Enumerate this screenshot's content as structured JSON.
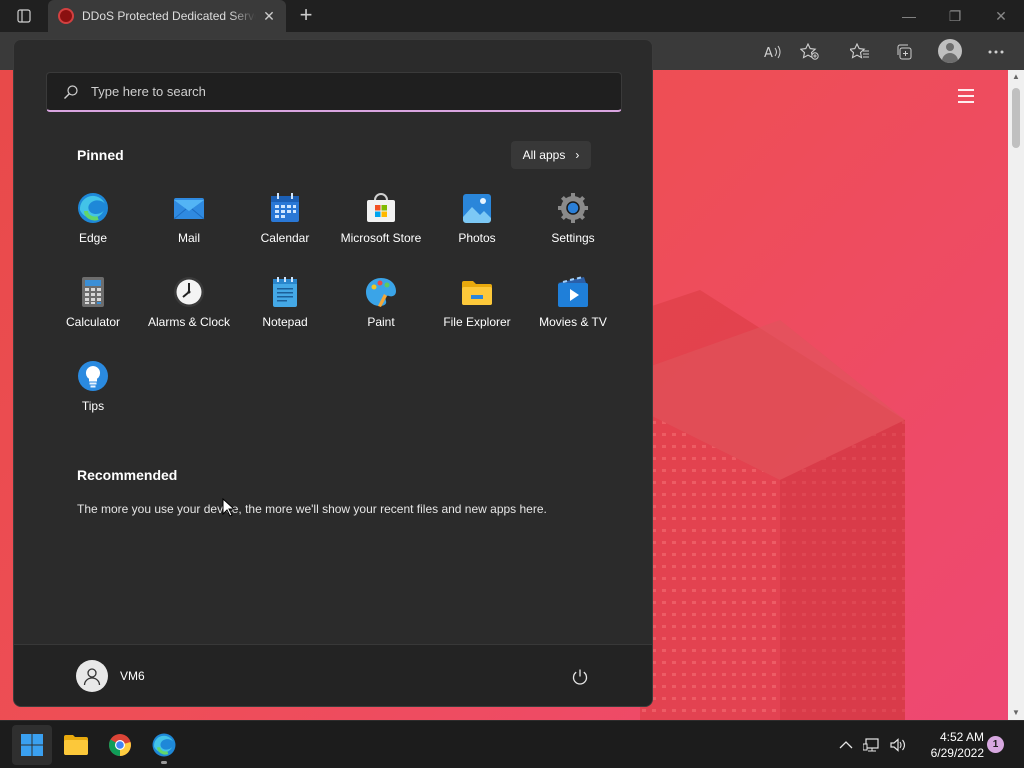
{
  "browser": {
    "tab": {
      "title": "DDoS Protected Dedicated Servers",
      "close_glyph": "✕"
    },
    "new_tab_glyph": "+",
    "window_controls": {
      "minimize": "—",
      "restore": "❐",
      "close": "✕"
    },
    "toolbar_icons": [
      "read-aloud-icon",
      "add-favorite-icon",
      "favorites-icon",
      "collections-icon",
      "profile-icon",
      "more-icon"
    ]
  },
  "start_menu": {
    "search": {
      "placeholder": "Type here to search"
    },
    "pinned_title": "Pinned",
    "all_apps_label": "All apps",
    "all_apps_chevron": "›",
    "pinned_apps": [
      {
        "label": "Edge",
        "icon": "edge-icon"
      },
      {
        "label": "Mail",
        "icon": "mail-icon"
      },
      {
        "label": "Calendar",
        "icon": "calendar-icon"
      },
      {
        "label": "Microsoft Store",
        "icon": "store-icon"
      },
      {
        "label": "Photos",
        "icon": "photos-icon"
      },
      {
        "label": "Settings",
        "icon": "settings-icon"
      },
      {
        "label": "Calculator",
        "icon": "calculator-icon"
      },
      {
        "label": "Alarms & Clock",
        "icon": "clock-icon"
      },
      {
        "label": "Notepad",
        "icon": "notepad-icon"
      },
      {
        "label": "Paint",
        "icon": "paint-icon"
      },
      {
        "label": "File Explorer",
        "icon": "folder-icon"
      },
      {
        "label": "Movies & TV",
        "icon": "movies-icon"
      },
      {
        "label": "Tips",
        "icon": "tips-icon"
      }
    ],
    "recommended_title": "Recommended",
    "recommended_text": "The more you use your device, the more we'll show your recent files and new apps here.",
    "user": {
      "name": "VM6"
    }
  },
  "taskbar": {
    "apps": [
      "start-icon",
      "file-explorer-icon",
      "chrome-icon",
      "edge-icon"
    ],
    "clock": {
      "time": "4:52 AM",
      "date": "6/29/2022"
    },
    "notification_count": "1",
    "colors": {
      "accent": "#d7a8e0",
      "start_blue": "#3aa0f0"
    }
  },
  "page": {
    "background_colors": [
      "#e84a4a",
      "#ee4873"
    ]
  }
}
